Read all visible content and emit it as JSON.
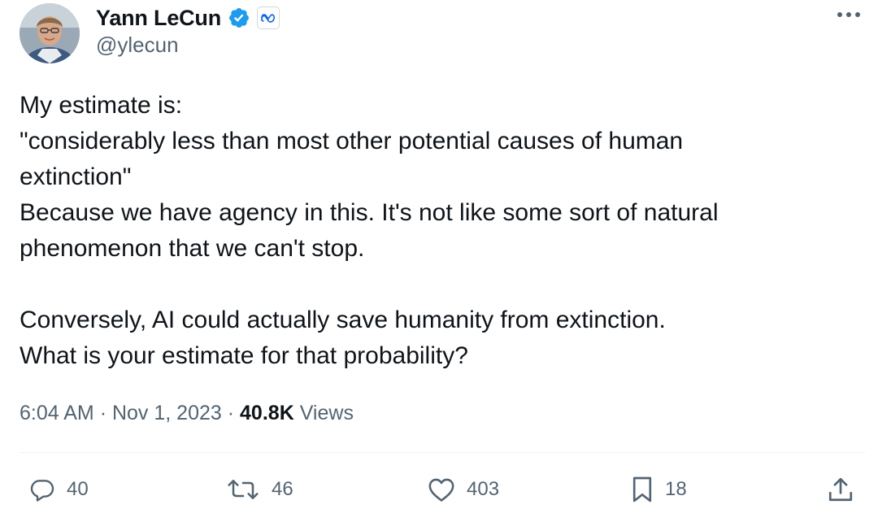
{
  "author": {
    "display_name": "Yann LeCun",
    "handle": "@ylecun",
    "avatar_icon": "profile-photo",
    "verified_icon": "verified-badge-icon",
    "affiliation_icon": "meta-logo-icon"
  },
  "menu": {
    "more_icon": "more-horizontal-icon"
  },
  "tweet": {
    "lines": [
      "My estimate is:",
      "\"considerably less than most other potential causes of human",
      "extinction\"",
      "Because we have agency in this. It's not like some sort of natural",
      "phenomenon that we can't stop.",
      "",
      "Conversely, AI could actually save humanity from extinction.",
      "What is your estimate for that probability?"
    ]
  },
  "meta": {
    "time": "6:04 AM",
    "separator": "·",
    "date": "Nov 1, 2023",
    "views_count": "40.8K",
    "views_label": "Views"
  },
  "actions": {
    "reply": {
      "icon": "reply-icon",
      "count": "40"
    },
    "retweet": {
      "icon": "retweet-icon",
      "count": "46"
    },
    "like": {
      "icon": "heart-icon",
      "count": "403"
    },
    "bookmark": {
      "icon": "bookmark-icon",
      "count": "18"
    },
    "share": {
      "icon": "share-icon"
    }
  },
  "colors": {
    "primary_text": "#0f1419",
    "secondary_text": "#536471",
    "verified_blue": "#1d9bf0",
    "divider": "#eff3f4"
  }
}
